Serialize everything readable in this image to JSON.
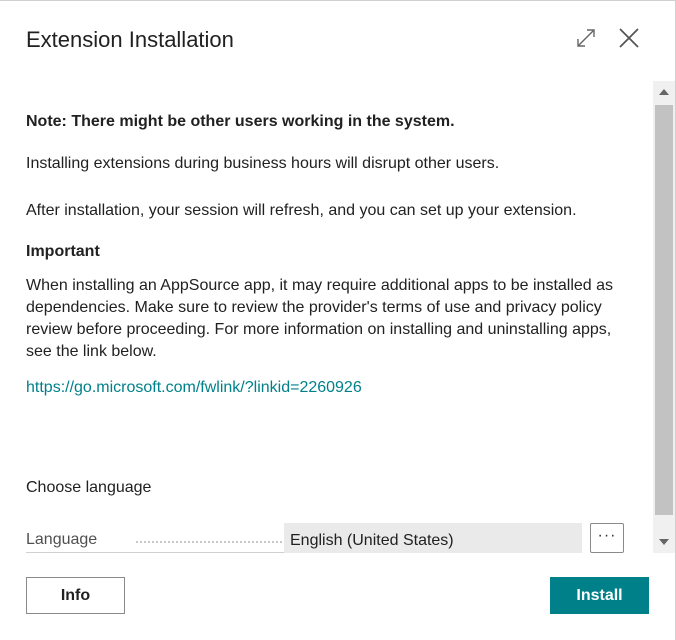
{
  "dialog": {
    "title": "Extension Installation",
    "expand_icon": "expand-icon",
    "close_icon": "close-icon"
  },
  "content": {
    "note": "Note: There might be other users working in the system.",
    "paragraph1": "Installing extensions during business hours will disrupt other users.",
    "paragraph2": "After installation, your session will refresh, and you can set up your extension.",
    "important_heading": "Important",
    "paragraph3": "When installing an AppSource app, it may require additional apps to be installed as dependencies. Make sure to review the provider's terms of use and privacy policy review before proceeding. For more information on installing and uninstalling apps, see the link below.",
    "link": "https://go.microsoft.com/fwlink/?linkid=2260926",
    "choose_language": "Choose language"
  },
  "language_field": {
    "label": "Language",
    "value": "English (United States)",
    "more_button": "···"
  },
  "footer": {
    "info_label": "Info",
    "install_label": "Install"
  },
  "colors": {
    "accent": "#00818a",
    "link": "#00818a"
  }
}
